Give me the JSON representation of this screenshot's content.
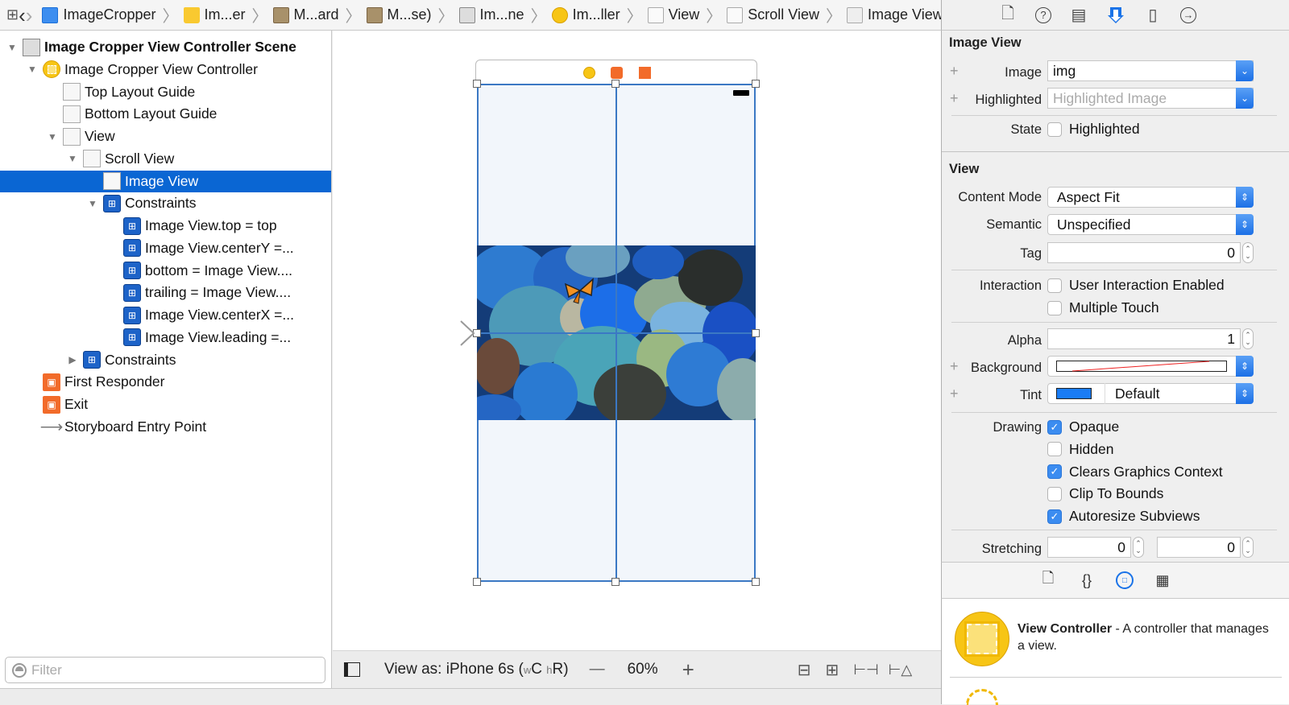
{
  "toolbar": {
    "grid_icon": "related-items-icon",
    "back": "‹",
    "forward": "›",
    "breadcrumbs": [
      {
        "label": "ImageCropper",
        "icon": "project-icon"
      },
      {
        "label": "Im...er",
        "icon": "folder-icon"
      },
      {
        "label": "M...ard",
        "icon": "storyboard-icon"
      },
      {
        "label": "M...se)",
        "icon": "storyboard-icon"
      },
      {
        "label": "Im...ne",
        "icon": "scene-icon"
      },
      {
        "label": "Im...ller",
        "icon": "view-controller-icon"
      },
      {
        "label": "View",
        "icon": "view-icon"
      },
      {
        "label": "Scroll View",
        "icon": "scroll-view-icon"
      },
      {
        "label": "Image View",
        "icon": "image-view-icon"
      }
    ]
  },
  "inspector_tabs": [
    "file-inspector",
    "quick-help",
    "identity-inspector",
    "attributes-inspector",
    "size-inspector",
    "connections-inspector"
  ],
  "inspector_active_tab": "attributes-inspector",
  "outline": {
    "items": [
      {
        "label": "Image Cropper View Controller Scene",
        "bold": true,
        "expanded": true
      },
      {
        "label": "Image Cropper View Controller",
        "expanded": true
      },
      {
        "label": "Top Layout Guide"
      },
      {
        "label": "Bottom Layout Guide"
      },
      {
        "label": "View",
        "expanded": true
      },
      {
        "label": "Scroll View",
        "expanded": true
      },
      {
        "label": "Image View",
        "selected": true
      },
      {
        "label": "Constraints",
        "expanded": true
      },
      {
        "label": "Image View.top = top"
      },
      {
        "label": "Image View.centerY =..."
      },
      {
        "label": "bottom = Image View...."
      },
      {
        "label": "trailing = Image View...."
      },
      {
        "label": "Image View.centerX =..."
      },
      {
        "label": "Image View.leading =..."
      },
      {
        "label": "Constraints",
        "expanded": false
      },
      {
        "label": "First Responder"
      },
      {
        "label": "Exit"
      },
      {
        "label": "Storyboard Entry Point"
      }
    ],
    "filter_placeholder": "Filter"
  },
  "canvas": {
    "view_as": "View as: iPhone 6s (",
    "size_w": "w",
    "size_w_val": "C",
    "size_h": "h",
    "size_h_val": "R)",
    "zoom_out": "—",
    "zoom_level": "60%",
    "zoom_in": "+",
    "image_description": "blue pebbles with orange butterfly"
  },
  "inspector": {
    "image_view_section": "Image View",
    "image_label": "Image",
    "image_value": "img",
    "highlighted_label": "Highlighted",
    "highlighted_placeholder": "Highlighted Image",
    "state_label": "State",
    "state_highlighted": "Highlighted",
    "state_highlighted_checked": false,
    "view_section": "View",
    "content_mode_label": "Content Mode",
    "content_mode_value": "Aspect Fit",
    "semantic_label": "Semantic",
    "semantic_value": "Unspecified",
    "tag_label": "Tag",
    "tag_value": "0",
    "interaction_label": "Interaction",
    "user_interaction": "User Interaction Enabled",
    "user_interaction_checked": false,
    "multiple_touch": "Multiple Touch",
    "multiple_touch_checked": false,
    "alpha_label": "Alpha",
    "alpha_value": "1",
    "background_label": "Background",
    "tint_label": "Tint",
    "tint_value": "Default",
    "tint_color": "#1a7cf5",
    "drawing_label": "Drawing",
    "drawing": [
      {
        "label": "Opaque",
        "checked": true
      },
      {
        "label": "Hidden",
        "checked": false
      },
      {
        "label": "Clears Graphics Context",
        "checked": true
      },
      {
        "label": "Clip To Bounds",
        "checked": false
      },
      {
        "label": "Autoresize Subviews",
        "checked": true
      }
    ],
    "stretching_label": "Stretching",
    "stretching_x": "0",
    "stretching_y": "0"
  },
  "library": {
    "tabs": [
      "file-template-icon",
      "code-snippet-icon",
      "object-library-icon",
      "media-library-icon"
    ],
    "active_tab": "object-library-icon",
    "item_title": "View Controller",
    "item_desc": " - A controller that manages a view."
  }
}
